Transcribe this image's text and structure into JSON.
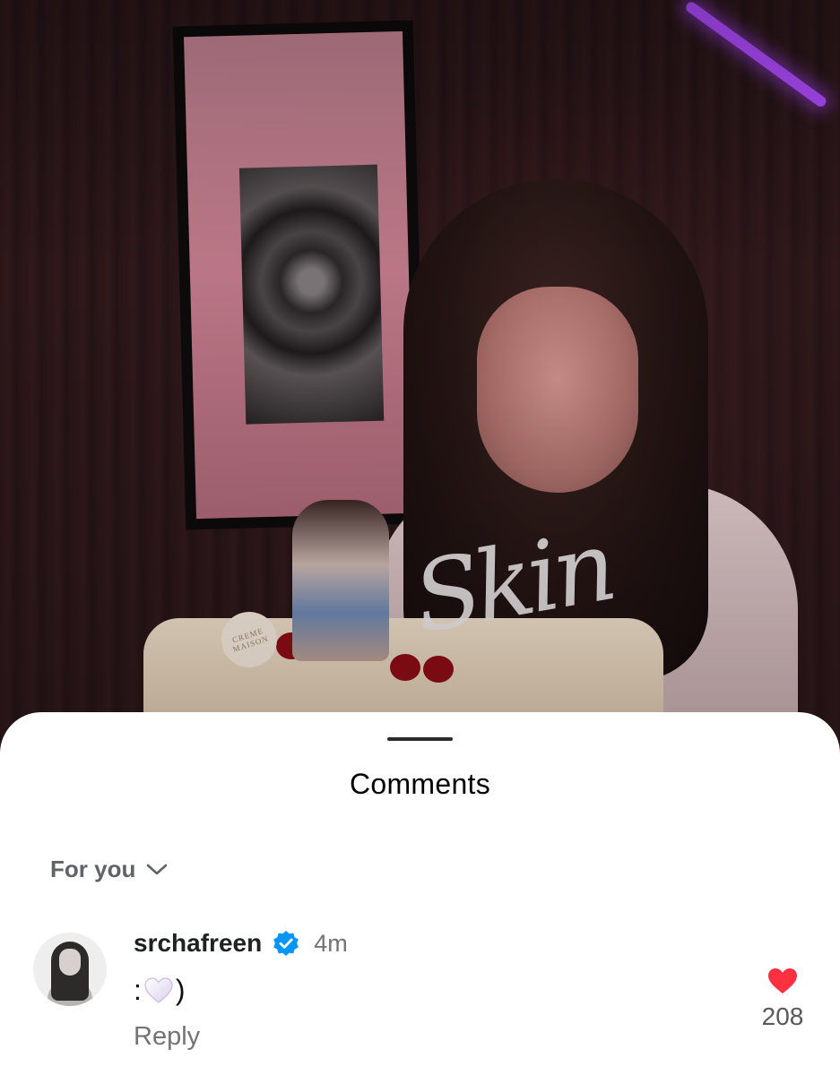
{
  "comments_sheet": {
    "title": "Comments",
    "filter_label": "For you",
    "accent_color": "#ff3040",
    "verified_color": "#0095f6"
  },
  "comment": {
    "username": "srchafreen",
    "verified": true,
    "time_ago": "4m",
    "text_prefix": ":",
    "text_suffix": ")",
    "emoji": "white-heart",
    "reply_label": "Reply",
    "like_count": "208",
    "liked": true
  },
  "photo": {
    "cake_badge": "CREME MAISON",
    "cake_topper_text": "Skin"
  }
}
